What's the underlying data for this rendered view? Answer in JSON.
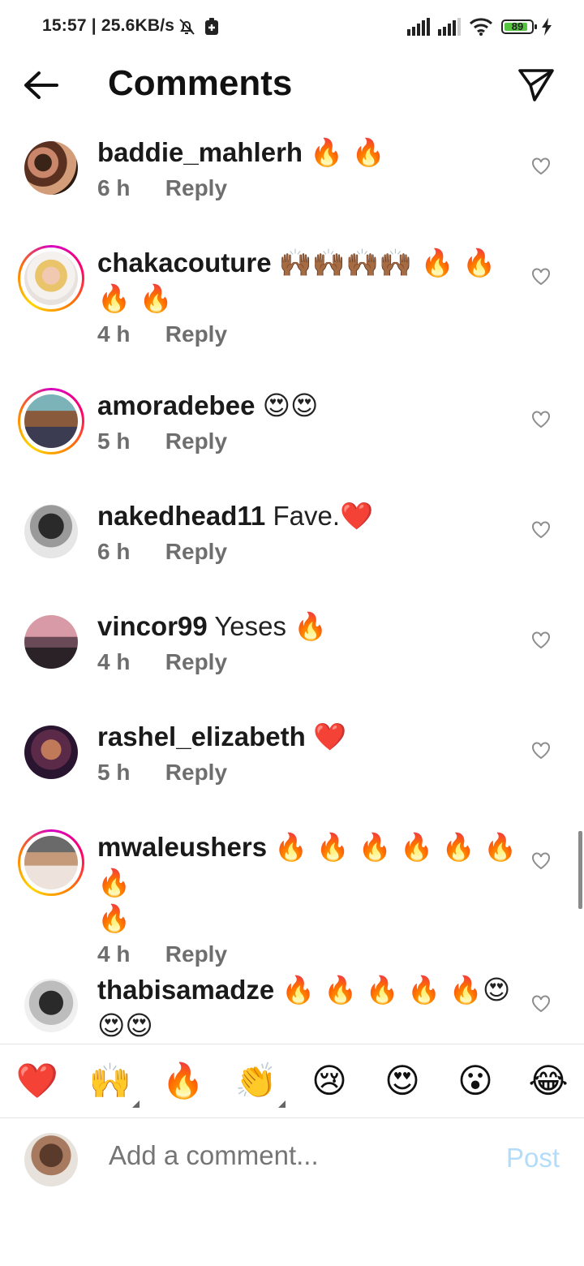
{
  "status_bar": {
    "time": "15:57 | 25.6KB/s",
    "battery_percent": "89",
    "battery_level": 0.89
  },
  "header": {
    "title": "Comments"
  },
  "comments": [
    {
      "username": "baddie_mahlerh",
      "text": "",
      "emoji": "🔥 🔥",
      "extra_emoji": "",
      "time": "6 h",
      "reply": "Reply",
      "story_ring": false
    },
    {
      "username": "chakacouture",
      "text": "",
      "emoji": "🙌🏾🙌🏾🙌🏾🙌🏾 🔥 🔥",
      "extra_emoji": "🔥 🔥",
      "time": "4 h",
      "reply": "Reply",
      "story_ring": true
    },
    {
      "username": "amoradebee",
      "text": "",
      "emoji": "😍😍",
      "extra_emoji": "",
      "time": "5 h",
      "reply": "Reply",
      "story_ring": true
    },
    {
      "username": "nakedhead11",
      "text": "Fave.",
      "emoji": "❤️",
      "extra_emoji": "",
      "time": "6 h",
      "reply": "Reply",
      "story_ring": false
    },
    {
      "username": "vincor99",
      "text": "Yeses",
      "emoji": "🔥",
      "extra_emoji": "",
      "time": "4 h",
      "reply": "Reply",
      "story_ring": false
    },
    {
      "username": "rashel_elizabeth",
      "text": "",
      "emoji": "❤️",
      "extra_emoji": "",
      "time": "5 h",
      "reply": "Reply",
      "story_ring": false
    },
    {
      "username": "mwaleushers",
      "text": "",
      "emoji": "🔥 🔥 🔥 🔥 🔥 🔥 🔥",
      "extra_emoji": "🔥",
      "time": "4 h",
      "reply": "Reply",
      "story_ring": true
    },
    {
      "username": "thabisamadze",
      "text": "",
      "emoji": "🔥 🔥 🔥 🔥 🔥😍",
      "extra_emoji": "😍😍",
      "time": "",
      "reply": "",
      "story_ring": false
    }
  ],
  "reaction_bar": {
    "items": [
      {
        "glyph": "❤️",
        "icon": "red-heart-icon"
      },
      {
        "glyph": "🙌",
        "icon": "raising-hands-icon"
      },
      {
        "glyph": "🔥",
        "icon": "fire-icon"
      },
      {
        "glyph": "👏",
        "icon": "clapping-hands-icon"
      },
      {
        "glyph": "😢",
        "icon": "crying-face-icon"
      },
      {
        "glyph": "😍",
        "icon": "heart-eyes-icon"
      },
      {
        "glyph": "😮",
        "icon": "surprised-face-icon"
      },
      {
        "glyph": "😂",
        "icon": "tears-of-joy-icon"
      }
    ]
  },
  "compose": {
    "placeholder": "Add a comment...",
    "post_label": "Post"
  },
  "colors": {
    "text": "#111111",
    "meta": "#6e6e6e",
    "post_disabled": "#b4dcf8",
    "divider": "#e3e3e3"
  }
}
